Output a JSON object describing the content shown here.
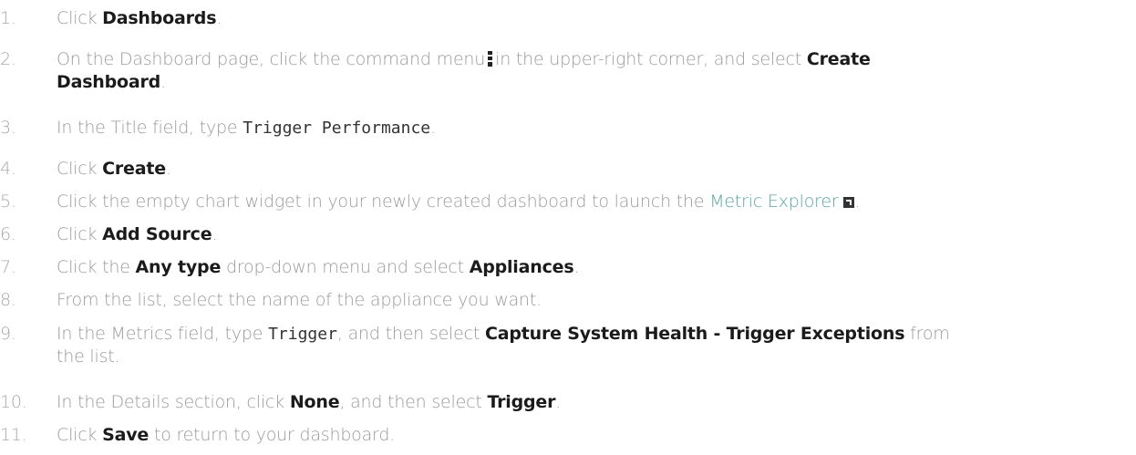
{
  "steps": [
    {
      "num": "1.",
      "pre": "Click ",
      "b1": "Dashboards",
      "post": "."
    },
    {
      "num": "2.",
      "pre": "On the Dashboard page, click the command menu",
      "mid": "in the upper-right corner, and select ",
      "b1": "Create",
      "b2": "Dashboard",
      "post": "."
    },
    {
      "num": "3.",
      "pre": "In the Title field, type ",
      "code": "Trigger Performance",
      "post": "."
    },
    {
      "num": "4.",
      "pre": "Click ",
      "b1": "Create",
      "post": "."
    },
    {
      "num": "5.",
      "pre": "Click the empty chart widget in your newly created dashboard to launch the ",
      "link": "Metric Explorer",
      "post": "."
    },
    {
      "num": "6.",
      "pre": "Click ",
      "b1": "Add Source",
      "post": "."
    },
    {
      "num": "7.",
      "pre": "Click the ",
      "b1": "Any type",
      "mid": " drop-down menu and select ",
      "b2": "Appliances",
      "post": "."
    },
    {
      "num": "8.",
      "pre": "From the list, select the name of the appliance you want."
    },
    {
      "num": "9.",
      "pre": "In the Metrics field, type ",
      "code": "Trigger",
      "mid": ", and then select ",
      "b1": "Capture System Health - Trigger Exceptions",
      "post": " from",
      "line2": "the list."
    },
    {
      "num": "10.",
      "pre": "In the Details section, click ",
      "b1": "None",
      "mid": ", and then select ",
      "b2": "Trigger",
      "post": "."
    },
    {
      "num": "11.",
      "pre": "Click ",
      "b1": "Save",
      "post": " to return to your dashboard."
    }
  ]
}
